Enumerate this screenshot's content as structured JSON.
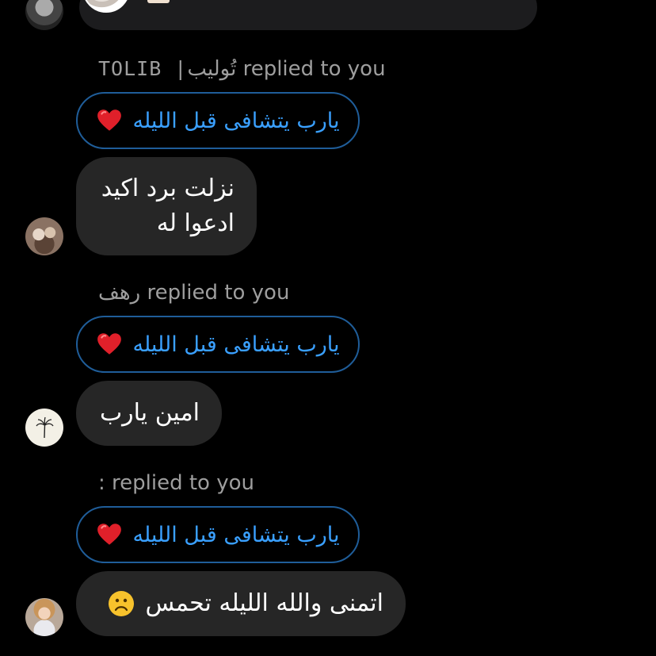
{
  "messages": [
    {
      "reply_label_latin": "TOLIB |",
      "reply_label_arabic": "تُوليب",
      "reply_suffix": "replied to you",
      "quote_text": "يارب يتشافى قبل الليله",
      "quote_emoji": "heart-icon",
      "body_lines": [
        "نزلت برد اكيد",
        "ادعوا له"
      ]
    },
    {
      "reply_label_arabic": "رهف",
      "reply_suffix": "replied to you",
      "quote_text": "يارب يتشافى قبل الليله",
      "quote_emoji": "heart-icon",
      "body_lines": [
        "امين يارب"
      ]
    },
    {
      "reply_prefix": ":",
      "reply_suffix": "replied to you",
      "quote_text": "يارب يتشافى قبل الليله",
      "quote_emoji": "heart-icon",
      "body_text": "اتمنى والله الليله تحمس",
      "body_emoji": "sad-face-icon"
    }
  ],
  "colors": {
    "background": "#000000",
    "bubble": "#262626",
    "quote_border": "#1f5d99",
    "quote_text": "#3aa0ff",
    "label": "#9e9e9e"
  }
}
